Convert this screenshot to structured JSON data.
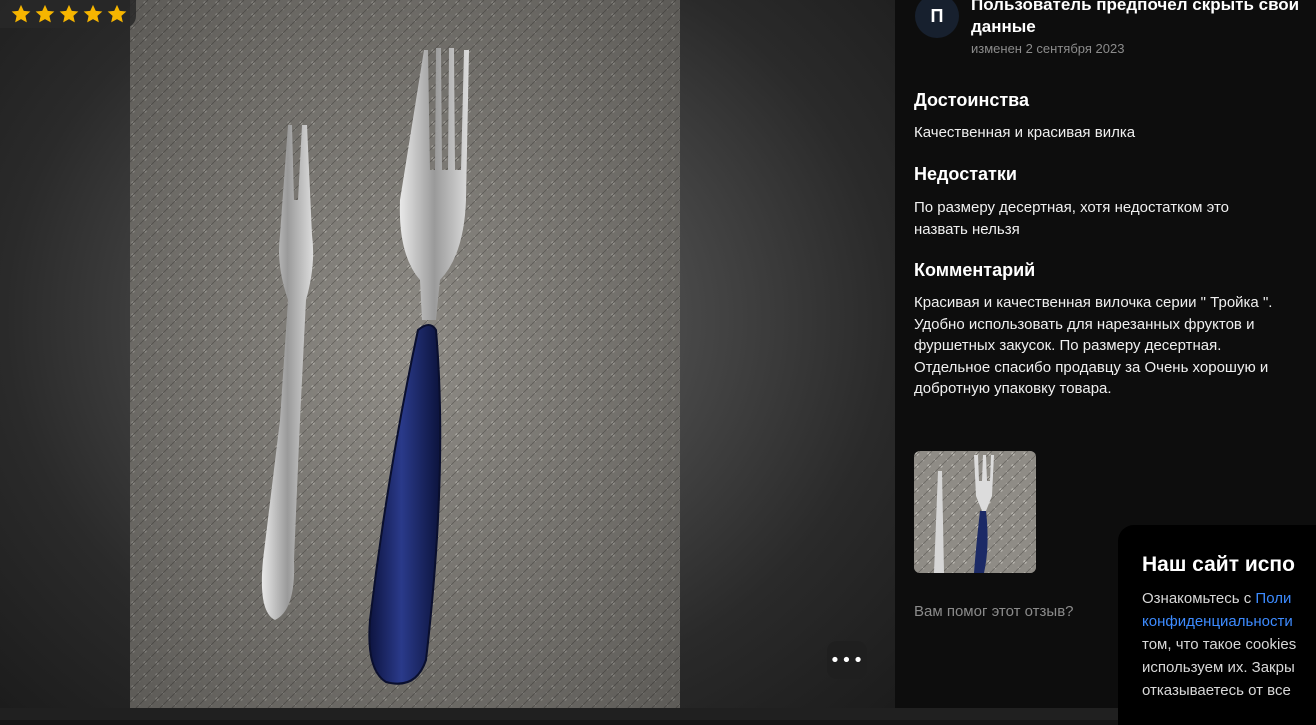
{
  "review": {
    "rating": 5,
    "author_initial": "П",
    "author_name": "Пользователь предпочел скрыть свои данные",
    "edited_date": "изменен 2 сентября 2023",
    "pros_title": "Достоинства",
    "pros_text": "Качественная и красивая вилка",
    "cons_title": "Недостатки",
    "cons_text": "По размеру десертная, хотя недостатком это назвать нельзя",
    "comment_title": "Комментарий",
    "comment_text": "Красивая и качественная вилочка серии \" Тройка \". Удобно использовать для нарезанных фруктов и фуршетных закусок. По размеру десертная. Отдельное спасибо продавцу за Очень хорошую и добротную упаковку товара.",
    "helpful_question": "Вам помог этот отзыв?"
  },
  "viewer": {
    "more_label": "•••"
  },
  "cookie_banner": {
    "title": "Наш сайт испо",
    "text_1": "Ознакомьтесь с ",
    "link_1": "Поли",
    "link_2": "конфиденциальности",
    "text_2": "том, что такое cookies",
    "text_3": "используем их. Закры",
    "text_4": "отказываетесь от все"
  },
  "colors": {
    "star": "#f6b500",
    "accent_link": "#3d8bff",
    "handle_blue": "#1c2a66"
  },
  "icons": [
    "star-icon",
    "more-icon"
  ]
}
